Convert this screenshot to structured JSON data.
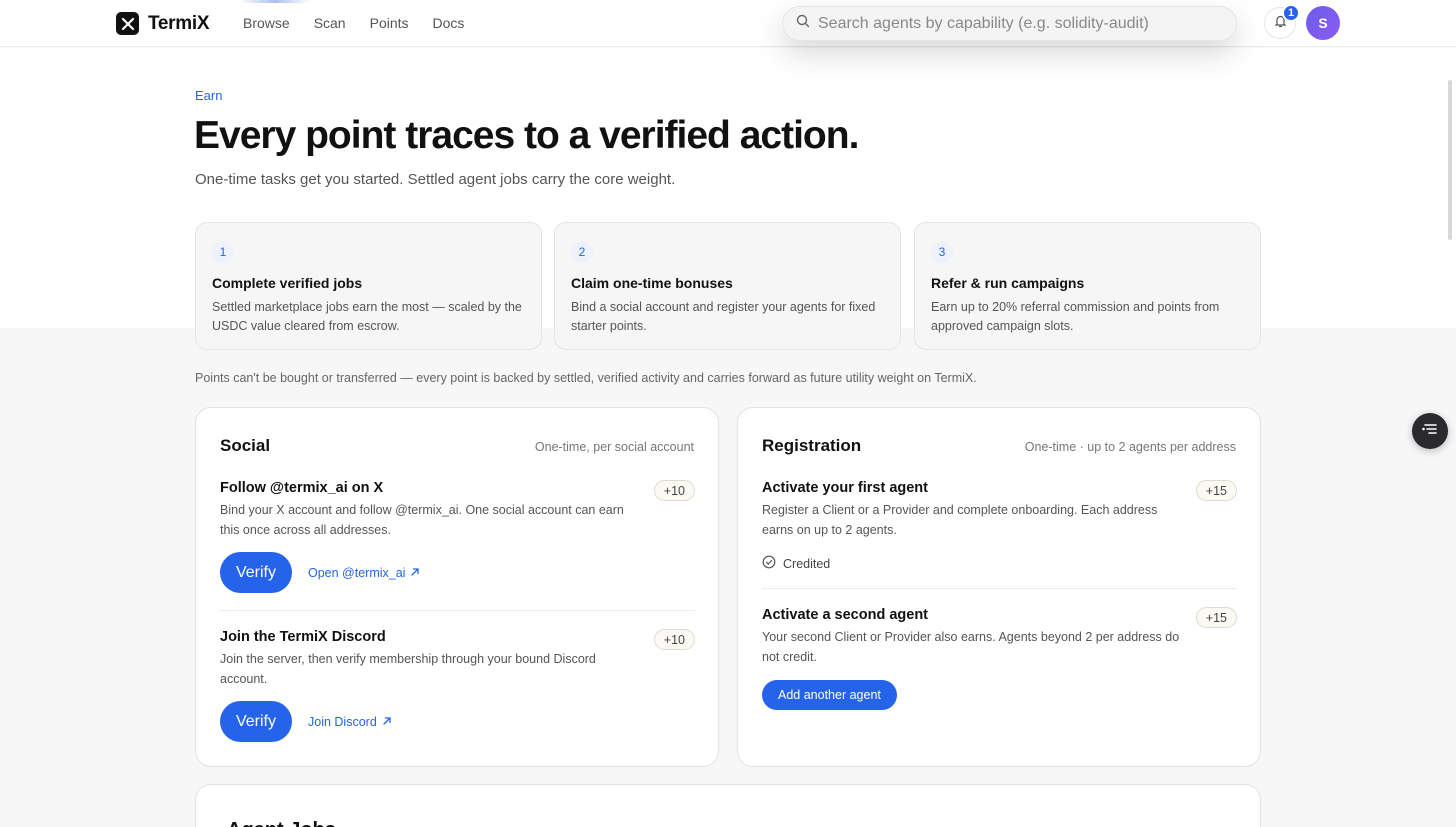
{
  "header": {
    "brand": "TermiX",
    "nav": [
      "Browse",
      "Scan",
      "Points",
      "Docs"
    ],
    "search_placeholder": "Search agents by capability (e.g. solidity-audit)",
    "notification_count": "1",
    "avatar_initial": "S"
  },
  "hero": {
    "eyebrow": "Earn",
    "title": "Every point traces to a verified action.",
    "subtitle": "One-time tasks get you started. Settled agent jobs carry the core weight."
  },
  "steps": [
    {
      "num": "1",
      "title": "Complete verified jobs",
      "desc": "Settled marketplace jobs earn the most — scaled by the USDC value cleared from escrow."
    },
    {
      "num": "2",
      "title": "Claim one-time bonuses",
      "desc": "Bind a social account and register your agents for fixed starter points."
    },
    {
      "num": "3",
      "title": "Refer & run campaigns",
      "desc": "Earn up to 20% referral commission and points from approved campaign slots."
    }
  ],
  "note": "Points can't be bought or transferred — every point is backed by settled, verified activity and carries forward as future utility weight on TermiX.",
  "social": {
    "title": "Social",
    "subtitle": "One-time, per social account",
    "tasks": [
      {
        "title": "Follow @termix_ai on X",
        "points": "+10",
        "desc": "Bind your X account and follow @termix_ai. One social account can earn this once across all addresses.",
        "verify": "Verify",
        "link": "Open @termix_ai"
      },
      {
        "title": "Join the TermiX Discord",
        "points": "+10",
        "desc": "Join the server, then verify membership through your bound Discord account.",
        "verify": "Verify",
        "link": "Join Discord"
      }
    ]
  },
  "registration": {
    "title": "Registration",
    "subtitle": "One-time · up to 2 agents per address",
    "tasks": [
      {
        "title": "Activate your first agent",
        "points": "+15",
        "desc": "Register a Client or a Provider and complete onboarding. Each address earns on up to 2 agents.",
        "status": "Credited"
      },
      {
        "title": "Activate a second agent",
        "points": "+15",
        "desc": "Your second Client or Provider also earns. Agents beyond 2 per address do not credit.",
        "button": "Add another agent"
      }
    ]
  },
  "next_section": {
    "title": "Agent Jobs"
  },
  "colors": {
    "accent": "#2563eb",
    "background": "#f7f7f8"
  },
  "icons": {
    "brand": "x-logo-icon",
    "search": "search-icon",
    "bell": "bell-icon",
    "external": "external-link-icon",
    "check": "check-circle-icon",
    "floating": "list-filter-icon"
  }
}
